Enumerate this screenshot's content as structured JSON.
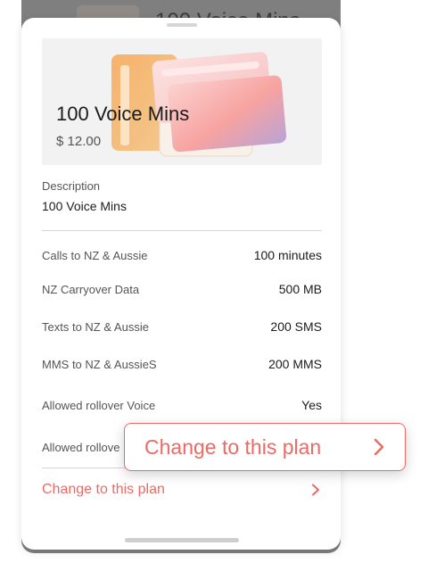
{
  "background": {
    "title": "100 Voice Mins"
  },
  "plan": {
    "name": "100 Voice Mins",
    "price": "$ 12.00"
  },
  "description": {
    "label": "Description",
    "value": "100 Voice Mins"
  },
  "details": [
    {
      "label": "Calls to NZ & Aussie",
      "value": "100 minutes"
    },
    {
      "label": "NZ Carryover Data",
      "value": "500 MB"
    },
    {
      "label": "Texts to NZ & Aussie",
      "value": "200 SMS"
    },
    {
      "label": "MMS to NZ & AussieS",
      "value": "200 MMS"
    },
    {
      "label": "Allowed rollover Voice",
      "value": "Yes"
    },
    {
      "label": "Allowed rollove",
      "value": ""
    }
  ],
  "action": {
    "change_label": "Change to this plan",
    "callout_label": "Change to this plan",
    "icon": "chevron-right-icon",
    "color": "#ec6a63"
  },
  "colors": {
    "accent": "#ec6a63",
    "hero_bg": "#f2f2f2",
    "backdrop": "#7f7f7f"
  }
}
